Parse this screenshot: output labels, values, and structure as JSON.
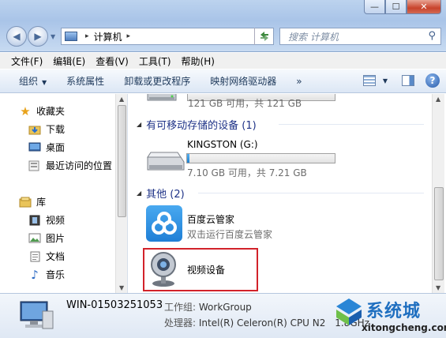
{
  "window": {
    "min_label": "—",
    "max_label": "☐",
    "close_label": "✕"
  },
  "nav": {
    "back_glyph": "◀",
    "forward_glyph": "▶"
  },
  "address": {
    "path": "计算机",
    "separator": "▸"
  },
  "search": {
    "placeholder": "搜索 计算机"
  },
  "menu": [
    "文件(F)",
    "编辑(E)",
    "查看(V)",
    "工具(T)",
    "帮助(H)"
  ],
  "commands": {
    "organize": "组织",
    "system_properties": "系统属性",
    "uninstall": "卸载或更改程序",
    "map_drive": "映射网络驱动器",
    "more": "»"
  },
  "sidebar": {
    "favorites": "收藏夹",
    "downloads": "下载",
    "desktop": "桌面",
    "recent": "最近访问的位置",
    "libraries": "库",
    "videos": "视频",
    "pictures": "图片",
    "documents": "文档",
    "music": "音乐"
  },
  "content": {
    "top_drive_space": "121 GB 可用，共 121 GB",
    "removable_header": "有可移动存储的设备 (1)",
    "kingston_name": "KINGSTON (G:)",
    "kingston_space": "7.10 GB 可用，共 7.21 GB",
    "kingston_used_fraction": 0.015,
    "other_header": "其他 (2)",
    "baidu_name": "百度云管家",
    "baidu_desc": "双击运行百度云管家",
    "video_device": "视频设备"
  },
  "details": {
    "computer_name": "WIN-01503251053",
    "workgroup_key": "工作组:",
    "workgroup_val": "WorkGroup",
    "processor_key": "处理器:",
    "processor_val": "Intel(R) Celeron(R) CPU  N2",
    "processor_tail": "1.8GHz"
  },
  "watermark": {
    "brand": "系统城",
    "url": "xitongcheng.com"
  },
  "colors": {
    "accent_blue": "#1e3287",
    "highlight_red": "#d2222a",
    "baidu_blue": "#2a8de0"
  }
}
